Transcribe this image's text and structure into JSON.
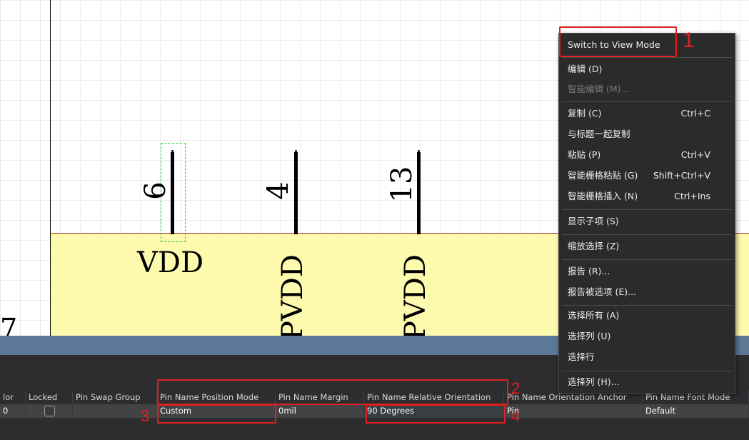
{
  "canvas": {
    "pins": [
      {
        "number": "6",
        "name": "VDD"
      },
      {
        "number": "4",
        "name": "PVDD"
      },
      {
        "number": "13",
        "name": "PVDD"
      }
    ],
    "edge_text": "7"
  },
  "context_menu": {
    "items": [
      {
        "label": "Switch to View Mode",
        "shortcut": ""
      },
      {
        "label": "编辑 (D)",
        "shortcut": ""
      },
      {
        "label": "智能编辑 (M)...",
        "shortcut": "",
        "disabled": true
      },
      {
        "label": "复制 (C)",
        "shortcut": "Ctrl+C"
      },
      {
        "label": "与标题一起复制",
        "shortcut": ""
      },
      {
        "label": "粘贴 (P)",
        "shortcut": "Ctrl+V"
      },
      {
        "label": "智能栅格粘贴 (G)",
        "shortcut": "Shift+Ctrl+V"
      },
      {
        "label": "智能栅格插入 (N)",
        "shortcut": "Ctrl+Ins"
      },
      {
        "label": "显示子项 (S)",
        "shortcut": ""
      },
      {
        "label": "缩放选择 (Z)",
        "shortcut": ""
      },
      {
        "label": "报告 (R)...",
        "shortcut": ""
      },
      {
        "label": "报告被选项 (E)...",
        "shortcut": ""
      },
      {
        "label": "选择所有 (A)",
        "shortcut": ""
      },
      {
        "label": "选择列 (U)",
        "shortcut": ""
      },
      {
        "label": "选择行",
        "shortcut": ""
      },
      {
        "label": "选择列 (H)...",
        "shortcut": ""
      }
    ]
  },
  "grid": {
    "headers": [
      "lor",
      "Locked",
      "Pin Swap Group",
      "Pin Name Position Mode",
      "Pin Name Margin",
      "Pin Name Relative Orientation",
      "Pin Name Orientation Anchor",
      "Pin Name Font Mode"
    ],
    "row": {
      "lor": "0",
      "locked": false,
      "pin_swap_group": "",
      "pin_name_position_mode": "Custom",
      "pin_name_margin": "0mil",
      "pin_name_relative_orientation": "90 Degrees",
      "pin_name_orientation_anchor": "Pin",
      "pin_name_font_mode": "Default"
    }
  },
  "annotations": [
    "1",
    "2",
    "3",
    "4"
  ],
  "colors": {
    "annotation_red": "#e02020",
    "component_body": "#fdfaae",
    "menu_bg": "#2b2b2b",
    "panel_bg": "#2d2d30"
  }
}
